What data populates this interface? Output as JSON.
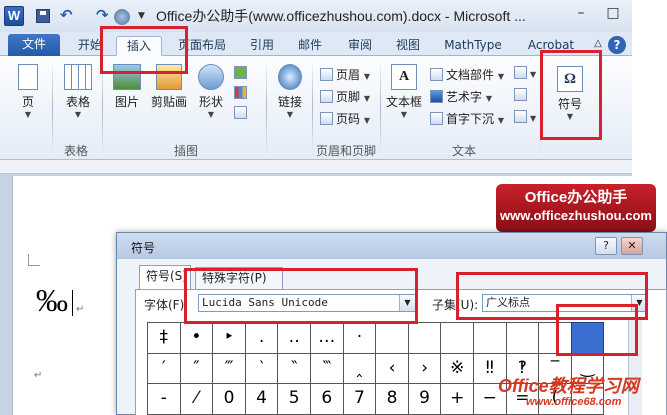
{
  "window": {
    "title": "Office办公助手(www.officezhushou.com).docx - Microsoft ...",
    "logo": "W",
    "minimize": "–",
    "restore": "□"
  },
  "tabs": [
    "文件",
    "开始",
    "插入",
    "页面布局",
    "引用",
    "邮件",
    "审阅",
    "视图",
    "MathType",
    "Acrobat"
  ],
  "active_tab": "插入",
  "ribbon": {
    "pages": {
      "label": "页",
      "group": ""
    },
    "tables": {
      "label": "表格",
      "group": "表格"
    },
    "illustrations": {
      "group": "插图",
      "picture": "图片",
      "clipart": "剪贴画",
      "shapes": "形状"
    },
    "links": {
      "label": "链接"
    },
    "header_footer": {
      "group": "页眉和页脚",
      "header": "页眉",
      "footer": "页脚",
      "page_number": "页码"
    },
    "text": {
      "group": "文本",
      "textbox": "文本框",
      "quickparts": "文档部件",
      "wordart": "艺术字",
      "dropcap": "首字下沉"
    },
    "symbols": {
      "label": "符号",
      "glyph": "Ω"
    }
  },
  "document": {
    "content": "‰"
  },
  "banner": {
    "title": "Office办公助手",
    "url": "www.officezhushou.com"
  },
  "dialog": {
    "title": "符号",
    "help": "?",
    "close": "✕",
    "tabs": [
      "符号(S)",
      "特殊字符(P)"
    ],
    "font_label": "字体(F):",
    "font_value": "Lucida Sans Unicode",
    "subset_label": "子集(U):",
    "subset_value": "广义标点",
    "grid_row1": [
      "‡",
      "•",
      "‣",
      "․",
      "‥",
      "…",
      "‧",
      "",
      "",
      "",
      "",
      "",
      "",
      "",
      "‰",
      "‱"
    ],
    "grid_row2": [
      "′",
      "″",
      "‴",
      "‵",
      "‶",
      "‷",
      "‸",
      "‹",
      "›",
      "※",
      "‼",
      "‽",
      "‾",
      "‿",
      "⁀",
      "⁁"
    ],
    "grid_row3": [
      "‐",
      "⁄",
      "0",
      "4",
      "5",
      "6",
      "7",
      "8",
      "9",
      "+",
      "−",
      "=",
      "(",
      "",
      "",
      ""
    ],
    "selected": "‰"
  },
  "watermark2": {
    "title": "Office教程学习网",
    "url": "www.office68.com"
  }
}
